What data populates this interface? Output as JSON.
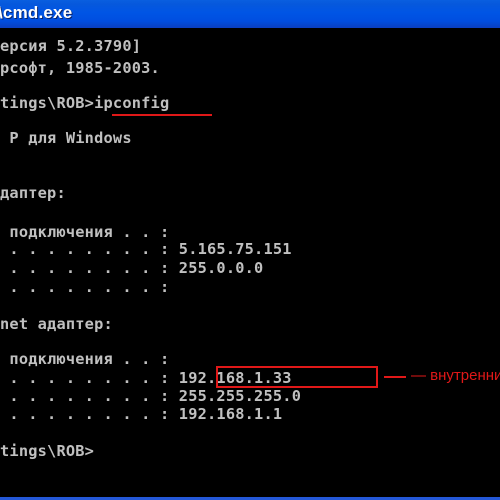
{
  "window": {
    "title": "\\cmd.exe"
  },
  "console": {
    "lines": [
      "ерсия 5.2.3790]",
      "рсофт, 1985-2003.",
      "",
      "tings\\ROB>ipconfig",
      "",
      " P для Windows",
      "",
      "",
      "дaптер:",
      "",
      " подключения . . :",
      " . . . . . . . . : 5.165.75.151",
      " . . . . . . . . : 255.0.0.0",
      " . . . . . . . . :",
      "",
      "net адаптер:",
      "",
      " подключения . . :",
      " . . . . . . . . : 192.168.1.33",
      " . . . . . . . . : 255.255.255.0",
      " . . . . . . . . : 192.168.1.1",
      "",
      "tings\\ROB>"
    ]
  },
  "annotation": {
    "text": "— внутренни",
    "color": "#e01818"
  }
}
